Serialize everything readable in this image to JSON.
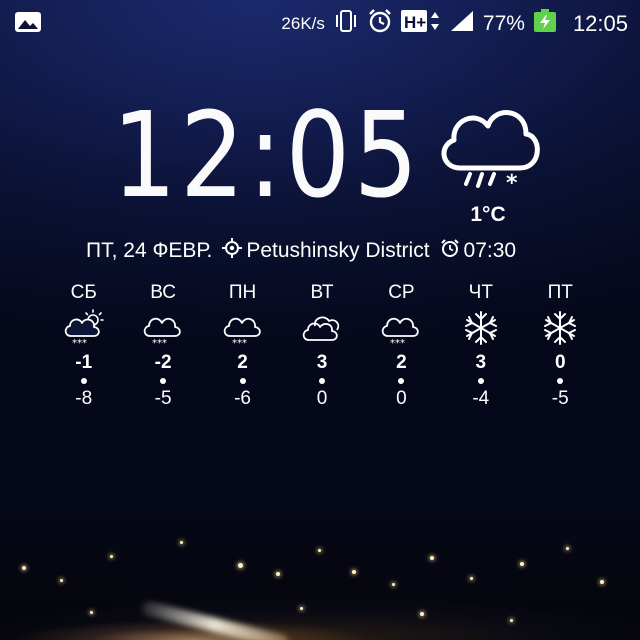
{
  "statusbar": {
    "net_speed": "26K/s",
    "network_type": "H+",
    "battery_percent": "77%",
    "time": "12:05",
    "icons": [
      "image-icon",
      "vibrate-icon",
      "alarm-clock-icon",
      "hplus-icon",
      "signal-icon",
      "battery-charging-icon"
    ]
  },
  "clock": {
    "time": "12:05"
  },
  "current_weather": {
    "condition": "rain-snow-cloud-icon",
    "temp": "1°C"
  },
  "info": {
    "date": "ПТ, 24 ФЕВР.",
    "location": "Petushinsky District",
    "alarm": "07:30"
  },
  "forecast": [
    {
      "day": "СБ",
      "icon": "partly-sunny-snow-icon",
      "high": "-1",
      "low": "-8"
    },
    {
      "day": "ВС",
      "icon": "cloud-snow-icon",
      "high": "-2",
      "low": "-5"
    },
    {
      "day": "ПН",
      "icon": "cloud-snow-icon",
      "high": "2",
      "low": "-6"
    },
    {
      "day": "ВТ",
      "icon": "cloudy-icon",
      "high": "3",
      "low": "0"
    },
    {
      "day": "СР",
      "icon": "cloud-snow-icon",
      "high": "2",
      "low": "0"
    },
    {
      "day": "ЧТ",
      "icon": "snowflake-icon",
      "high": "3",
      "low": "-4"
    },
    {
      "day": "ПТ",
      "icon": "snowflake-icon",
      "high": "0",
      "low": "-5"
    }
  ],
  "colors": {
    "battery_green": "#5fd14a",
    "text": "#ffffff"
  }
}
